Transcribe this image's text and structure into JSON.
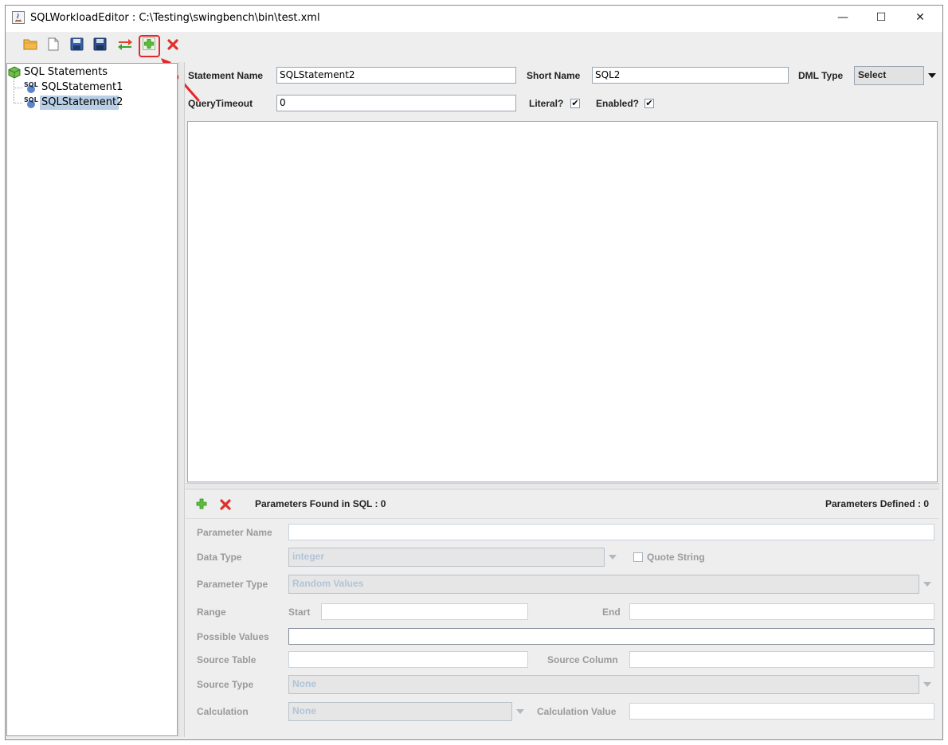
{
  "window": {
    "title": "SQLWorkloadEditor : C:\\Testing\\swingbench\\bin\\test.xml",
    "minimize_glyph": "—",
    "maximize_glyph": "☐",
    "close_glyph": "✕"
  },
  "toolbar": {
    "buttons": [
      {
        "icon": "open-folder-icon",
        "color": "#e8a13a"
      },
      {
        "icon": "new-file-icon",
        "color": "#ffffff"
      },
      {
        "icon": "save-icon",
        "color": "#2b4f8a"
      },
      {
        "icon": "save-as-icon",
        "color": "#2b4f8a"
      },
      {
        "icon": "swap-icon",
        "color": "#d23b2b"
      },
      {
        "icon": "add-icon",
        "color": "#3aa83a"
      },
      {
        "icon": "delete-icon",
        "color": "#d93030"
      }
    ],
    "highlight_color": "#e5262b"
  },
  "tree": {
    "root_label": "SQL Statements",
    "items": [
      {
        "badge": "SQL",
        "label": "SQLStatement1",
        "selected": false
      },
      {
        "badge": "SQL",
        "label": "SQLStatement2",
        "selected": true
      }
    ],
    "selection_color": "#b8cfe5"
  },
  "statement": {
    "name_label": "Statement Name",
    "name_value": "SQLStatement2",
    "short_name_label": "Short Name",
    "short_name_value": "SQL2",
    "dml_type_label": "DML Type",
    "dml_type_value": "Select",
    "query_timeout_label": "QueryTimeout",
    "query_timeout_value": "0",
    "literal_label": "Literal?",
    "literal_checked": true,
    "enabled_label": "Enabled?",
    "enabled_checked": true,
    "check_glyph": "✔"
  },
  "parameters": {
    "found_label": "Parameters Found in SQL : 0",
    "defined_label": "Parameters Defined : 0",
    "parameter_name_label": "Parameter Name",
    "data_type_label": "Data Type",
    "data_type_value": "integer",
    "quote_string_label": "Quote String",
    "parameter_type_label": "Parameter Type",
    "parameter_type_value": "Random Values",
    "range_label": "Range",
    "start_label": "Start",
    "end_label": "End",
    "possible_values_label": "Possible Values",
    "source_table_label": "Source Table",
    "source_column_label": "Source Column",
    "source_type_label": "Source Type",
    "source_type_value": "None",
    "calculation_label": "Calculation",
    "calculation_value": "None",
    "calculation_value_label": "Calculation Value"
  }
}
